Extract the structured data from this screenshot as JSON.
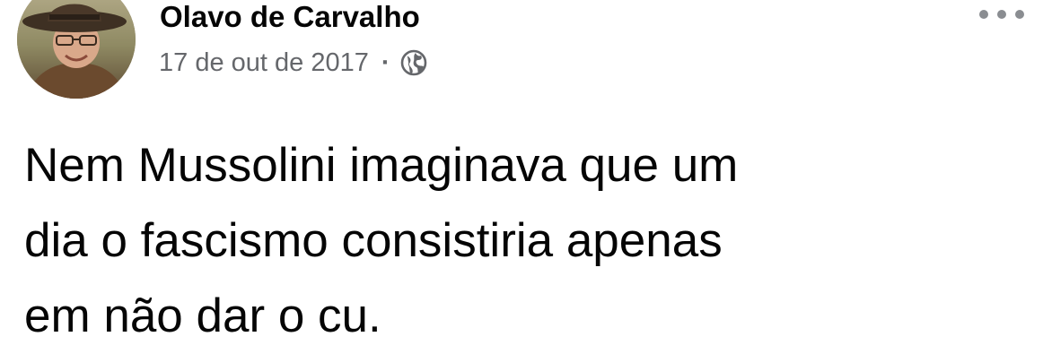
{
  "post": {
    "author": "Olavo de Carvalho",
    "date": "17 de out de 2017",
    "separator": "·",
    "privacy_icon": "globe-icon",
    "more_icon": "more-options-icon",
    "avatar_icon": "profile-photo",
    "text": "Nem Mussolini imaginava que um\ndia o fascismo consistiria apenas\nem não dar o cu."
  },
  "colors": {
    "name": "#050505",
    "meta": "#65676b",
    "icon": "#65676b",
    "background": "#ffffff"
  }
}
